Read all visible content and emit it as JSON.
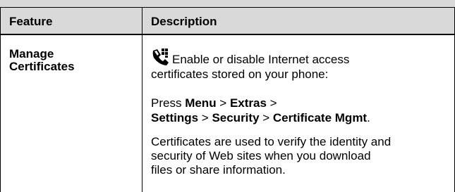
{
  "table": {
    "headers": {
      "feature": "Feature",
      "description": "Description"
    },
    "row": {
      "feature_lines": [
        "Manage",
        "Certificates"
      ],
      "icon": "phone-network-icon",
      "para1_line1": "Enable or disable Internet access",
      "para1_line2": "certificates stored on your phone:",
      "para2": {
        "press": "Press ",
        "menu": "Menu",
        "sep1": " > ",
        "extras": "Extras",
        "sep2": " >",
        "settings": "Settings",
        "sep3": " > ",
        "security": "Security",
        "sep4": " > ",
        "cert_mgmt": "Certificate Mgmt",
        "end": "."
      },
      "para3_lines": [
        "Certificates are used to verify the identity and",
        "security of Web sites when you download",
        "files or share information."
      ]
    }
  },
  "colors": {
    "header_bg": "#d9d9d9",
    "border": "#000000"
  }
}
